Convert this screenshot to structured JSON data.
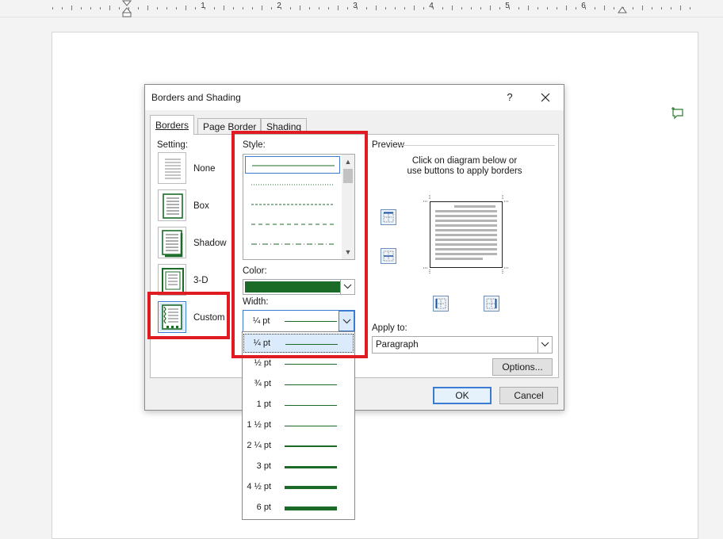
{
  "ruler": {
    "numbers": [
      "1",
      "2",
      "3",
      "4",
      "5",
      "6"
    ]
  },
  "dialog": {
    "title": "Borders and Shading",
    "help": "?",
    "tabs": [
      {
        "label": "Borders",
        "mnemonic_index": 0
      },
      {
        "label": "Page Border",
        "mnemonic_index": 0
      },
      {
        "label": "Shading",
        "mnemonic_index": 0
      }
    ],
    "setting": {
      "label": "Setting:",
      "items": [
        {
          "label": "None"
        },
        {
          "label": "Box"
        },
        {
          "label": "Shadow"
        },
        {
          "label": "3-D"
        },
        {
          "label": "Custom"
        }
      ],
      "selected": "Custom"
    },
    "style": {
      "label": "Style:"
    },
    "color": {
      "label": "Color:",
      "value": "#1b6b27"
    },
    "width": {
      "label": "Width:",
      "value": "¼ pt"
    },
    "preview": {
      "label": "Preview",
      "instruction_line1": "Click on diagram below or",
      "instruction_line2": "use buttons to apply borders"
    },
    "apply_to": {
      "label": "Apply to:",
      "value": "Paragraph"
    },
    "options_button": "Options...",
    "ok_button": "OK",
    "cancel_button": "Cancel"
  },
  "width_dropdown": {
    "items": [
      {
        "label": "¼ pt",
        "weight": 0.25
      },
      {
        "label": "½ pt",
        "weight": 0.5
      },
      {
        "label": "¾ pt",
        "weight": 0.75
      },
      {
        "label": "1 pt",
        "weight": 1
      },
      {
        "label": "1 ½ pt",
        "weight": 1.5
      },
      {
        "label": "2 ¼ pt",
        "weight": 2.25
      },
      {
        "label": "3 pt",
        "weight": 3
      },
      {
        "label": "4 ½ pt",
        "weight": 4.5
      },
      {
        "label": "6 pt",
        "weight": 6
      }
    ],
    "selected": "¼ pt"
  },
  "colors": {
    "border_green": "#1b6b27",
    "highlight_red": "#e11b22",
    "accent_blue": "#3c7bd4"
  }
}
